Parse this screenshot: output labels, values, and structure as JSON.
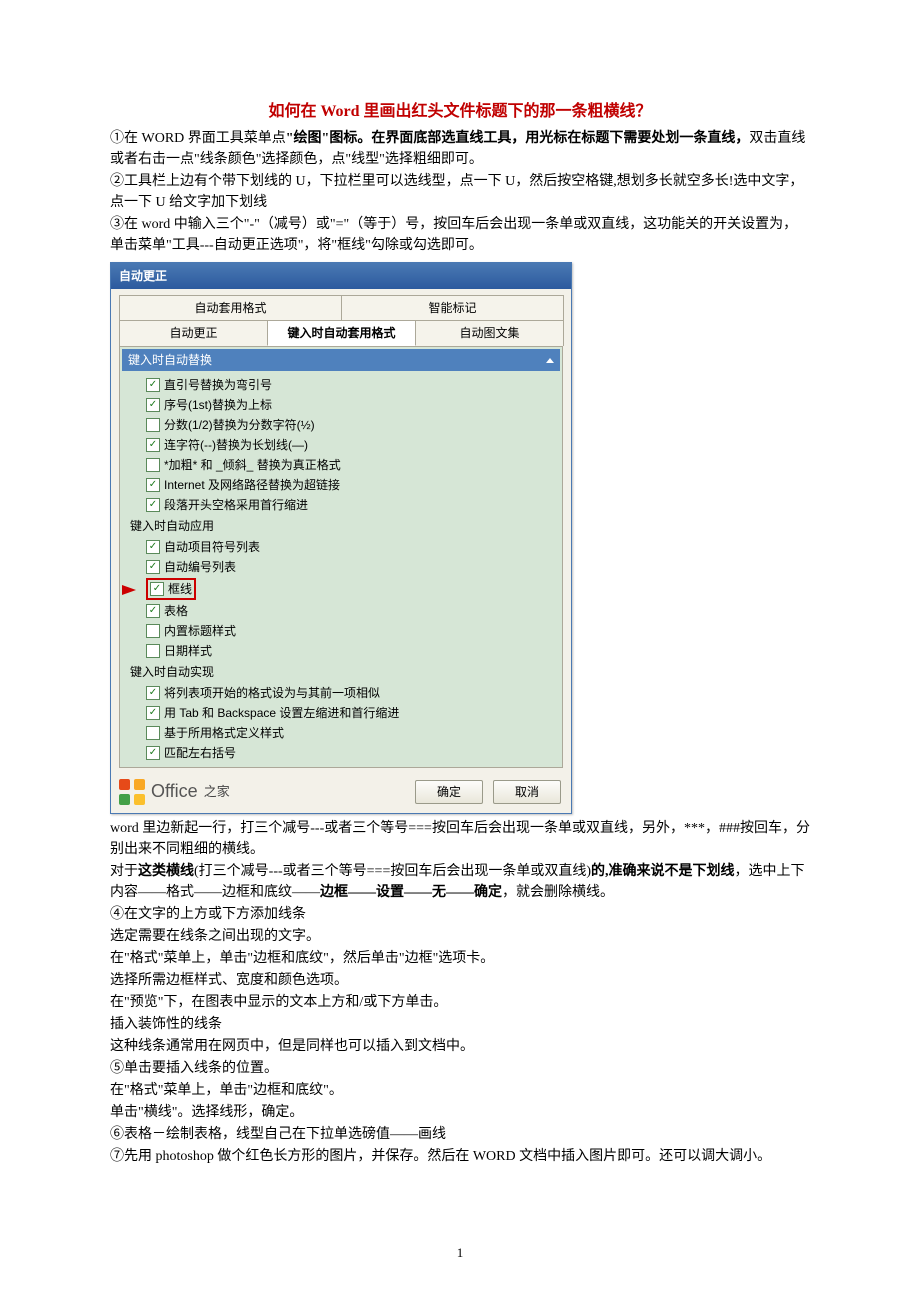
{
  "title": "如何在 Word 里画出红头文件标题下的那一条粗横线？",
  "para1_a": "①在 WORD 界面工具菜单点",
  "para1_b": "\"绘图\"图标。在界面底部选直线工具，用光标在标题下需要处划一条直线，",
  "para1_c": "双击直线或者右击一点\"线条颜色\"选择颜色，点\"线型\"选择粗细即可。",
  "para2": "②工具栏上边有个带下划线的 U，下拉栏里可以选线型，点一下 U，然后按空格键,想划多长就空多长!选中文字，点一下 U 给文字加下划线",
  "para3": "③在 word 中输入三个\"-\"（减号）或\"=\"（等于）号，按回车后会出现一条单或双直线，这功能关的开关设置为，单击菜单\"工具---自动更正选项\"，将\"框线\"勾除或勾选即可。",
  "dialog": {
    "title": "自动更正",
    "tabs_top": [
      "自动套用格式",
      "智能标记"
    ],
    "tabs_bottom": [
      "自动更正",
      "键入时自动套用格式",
      "自动图文集"
    ],
    "panel_header": "键入时自动替换",
    "group1_items": [
      {
        "label": "直引号替换为弯引号",
        "checked": true
      },
      {
        "label": "序号(1st)替换为上标",
        "checked": true
      },
      {
        "label": "分数(1/2)替换为分数字符(½)",
        "checked": false
      },
      {
        "label": "连字符(--)替换为长划线(—)",
        "checked": true
      },
      {
        "label": "*加粗* 和 _倾斜_ 替换为真正格式",
        "checked": false
      },
      {
        "label": "Internet 及网络路径替换为超链接",
        "checked": true
      },
      {
        "label": "段落开头空格采用首行缩进",
        "checked": true
      }
    ],
    "group2_label": "键入时自动应用",
    "group2_items": [
      {
        "label": "自动项目符号列表",
        "checked": true
      },
      {
        "label": "自动编号列表",
        "checked": true
      },
      {
        "label": "框线",
        "checked": true,
        "highlight": true
      },
      {
        "label": "表格",
        "checked": true
      },
      {
        "label": "内置标题样式",
        "checked": false
      },
      {
        "label": "日期样式",
        "checked": false
      }
    ],
    "group3_label": "键入时自动实现",
    "group3_items": [
      {
        "label": "将列表项开始的格式设为与其前一项相似",
        "checked": true
      },
      {
        "label": "用 Tab 和 Backspace 设置左缩进和首行缩进",
        "checked": true
      },
      {
        "label": "基于所用格式定义样式",
        "checked": false
      },
      {
        "label": "匹配左右括号",
        "checked": true
      }
    ],
    "logo_text": "Office",
    "logo_suffix": "之家",
    "ok": "确定",
    "cancel": "取消"
  },
  "post1": "word 里边新起一行，打三个减号---或者三个等号===按回车后会出现一条单或双直线，另外，***，###按回车，分别出来不同粗细的横线。",
  "post2_a": "  对于",
  "post2_b": "这类横线",
  "post2_c": "(打三个减号---或者三个等号===按回车后会出现一条单或双直线)",
  "post2_d": "的,准确来说不是下划线",
  "post2_e": "，选中上下内容——格式——边框和底纹——",
  "post2_f": "边框——设置——无——确定",
  "post2_g": "，就会删除横线。",
  "post3": "④在文字的上方或下方添加线条",
  "post4": "选定需要在线条之间出现的文字。",
  "post5": "在\"格式\"菜单上，单击\"边框和底纹\"，然后单击\"边框\"选项卡。",
  "post6": "选择所需边框样式、宽度和颜色选项。",
  "post7": "在\"预览\"下，在图表中显示的文本上方和/或下方单击。",
  "post8": "插入装饰性的线条",
  "post9": "这种线条通常用在网页中，但是同样也可以插入到文档中。",
  "post10": "⑤单击要插入线条的位置。",
  "post11": "在\"格式\"菜单上，单击\"边框和底纹\"。",
  "post12": "单击\"横线\"。选择线形，确定。",
  "post13": "⑥表格－绘制表格，线型自己在下拉单选磅值——画线",
  "post14": "⑦先用 photoshop 做个红色长方形的图片，并保存。然后在 WORD 文档中插入图片即可。还可以调大调小。",
  "page_number": "1"
}
